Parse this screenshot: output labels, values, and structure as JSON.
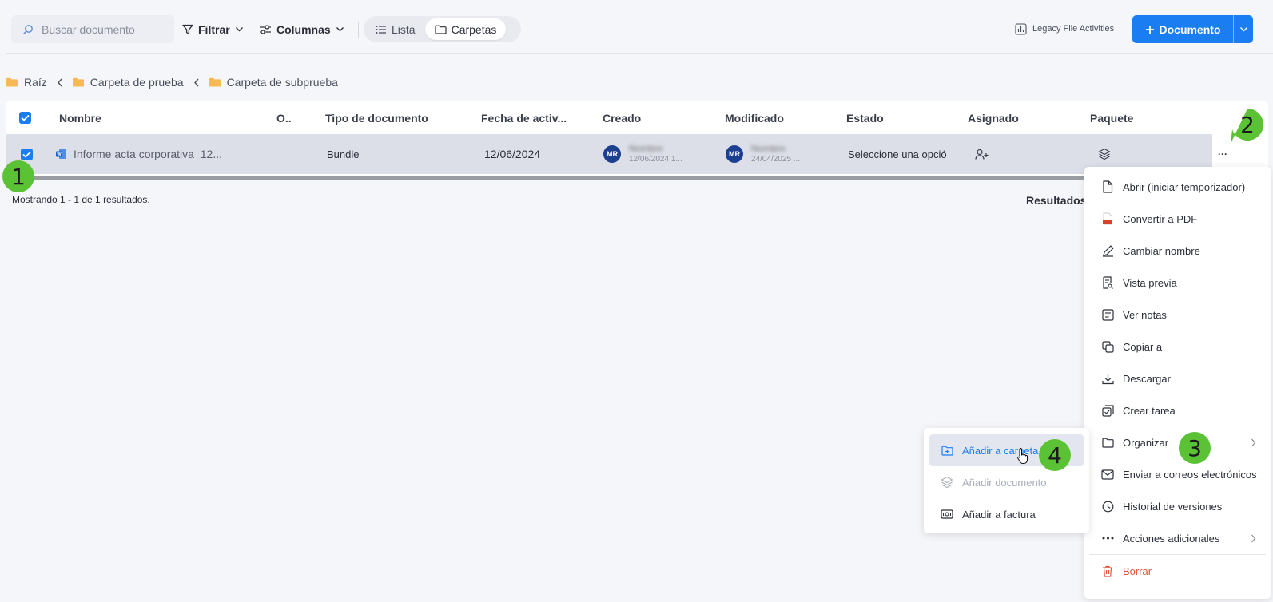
{
  "toolbar": {
    "search_placeholder": "Buscar documento",
    "filter_label": "Filtrar",
    "columns_label": "Columnas",
    "view_list": "Lista",
    "view_folders": "Carpetas",
    "legacy_label": "Legacy File Activities",
    "new_document_label": "Documento"
  },
  "breadcrumb": [
    "Raíz",
    "Carpeta de prueba",
    "Carpeta de subprueba"
  ],
  "table": {
    "headers": [
      "Nombre",
      "O..",
      "Tipo de documento",
      "Fecha de activ...",
      "Creado",
      "Modificado",
      "Estado",
      "Asignado",
      "Paquete"
    ],
    "row": {
      "name": "Informe acta corporativa_12...",
      "doc_type": "Bundle",
      "activity_date": "12/06/2024",
      "created_avatar": "MR",
      "created_name": "Nombre",
      "created_sub": "12/06/2024 1...",
      "modified_avatar": "MR",
      "modified_name": "Nombre",
      "modified_sub": "24/04/2025 ...",
      "status": "Seleccione una opció",
      "more": "···"
    }
  },
  "footer": {
    "count_text": "Mostrando 1 - 1 de 1 resultados.",
    "results_label": "Resultados"
  },
  "context_menu": {
    "items": [
      {
        "label": "Abrir (iniciar temporizador)",
        "icon": "file-icon"
      },
      {
        "label": "Convertir a PDF",
        "icon": "pdf-icon"
      },
      {
        "label": "Cambiar nombre",
        "icon": "pencil-icon"
      },
      {
        "label": "Vista previa",
        "icon": "preview-icon"
      },
      {
        "label": "Ver notas",
        "icon": "notes-icon"
      },
      {
        "label": "Copiar a",
        "icon": "copy-icon"
      },
      {
        "label": "Descargar",
        "icon": "download-icon"
      },
      {
        "label": "Crear tarea",
        "icon": "task-icon"
      },
      {
        "label": "Organizar",
        "icon": "folder-icon"
      },
      {
        "label": "Enviar a correos electrónicos",
        "icon": "mail-icon"
      },
      {
        "label": "Historial de versiones",
        "icon": "clock-icon"
      },
      {
        "label": "Acciones adicionales",
        "icon": "dots-icon"
      }
    ],
    "delete_label": "Borrar"
  },
  "submenu": {
    "items": [
      {
        "label": "Añadir a carpeta",
        "icon": "folder-plus-icon"
      },
      {
        "label": "Añadir documento",
        "icon": "layers-icon"
      },
      {
        "label": "Añadir a factura",
        "icon": "invoice-icon"
      }
    ]
  },
  "steps": [
    "1",
    "2",
    "3",
    "4"
  ],
  "colors": {
    "primary": "#1a7ef2",
    "step_marker": "#5bc236",
    "danger": "#e0533c",
    "selected_row": "#dcdee8"
  }
}
